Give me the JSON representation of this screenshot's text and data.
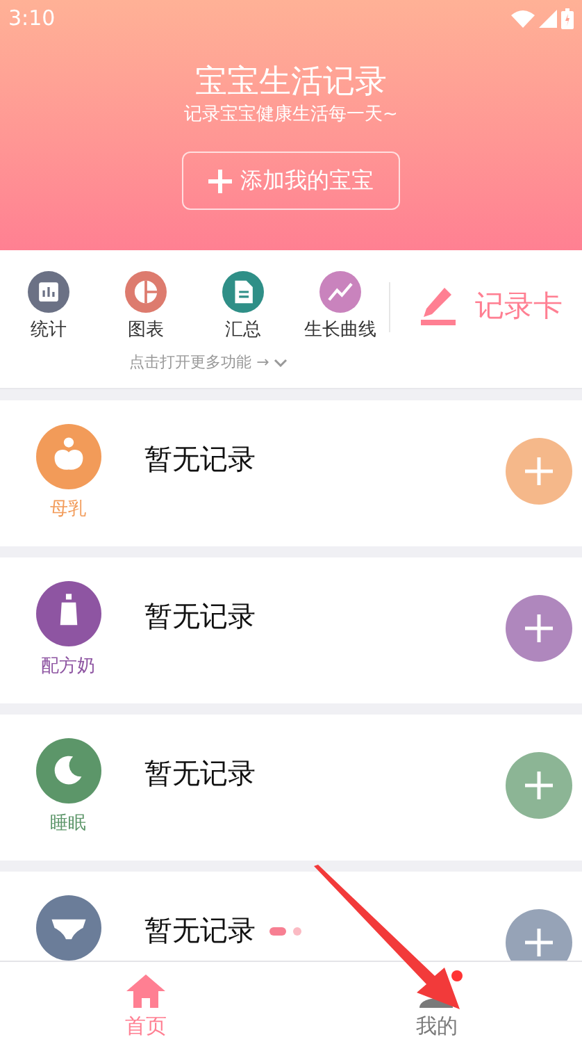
{
  "status_bar": {
    "time": "3:10"
  },
  "header": {
    "title": "宝宝生活记录",
    "subtitle": "记录宝宝健康生活每一天~",
    "add_button": "添加我的宝宝"
  },
  "quick_actions": [
    {
      "kind": "stats",
      "label": "统计",
      "color": "#6b7185"
    },
    {
      "kind": "chart",
      "label": "图表",
      "color": "#dd7b6e"
    },
    {
      "kind": "summary",
      "label": "汇总",
      "color": "#2f8f87"
    },
    {
      "kind": "growth",
      "label": "生长曲线",
      "color": "#c983bd"
    }
  ],
  "record_card": {
    "label": "记录卡"
  },
  "more_hint": "点击打开更多功能 →",
  "records": [
    {
      "kind": "breastmilk",
      "label": "母乳",
      "status": "暂无记录",
      "color": "#f29b59"
    },
    {
      "kind": "formula",
      "label": "配方奶",
      "status": "暂无记录",
      "color": "#8e55a2"
    },
    {
      "kind": "sleep",
      "label": "睡眠",
      "status": "暂无记录",
      "color": "#5c9669"
    },
    {
      "kind": "diaper",
      "status": "暂无记录",
      "color": "#6b7d99"
    }
  ],
  "bottom_nav": [
    {
      "kind": "home",
      "label": "首页",
      "selected": true
    },
    {
      "kind": "profile",
      "label": "我的",
      "selected": false,
      "badge": true
    }
  ]
}
